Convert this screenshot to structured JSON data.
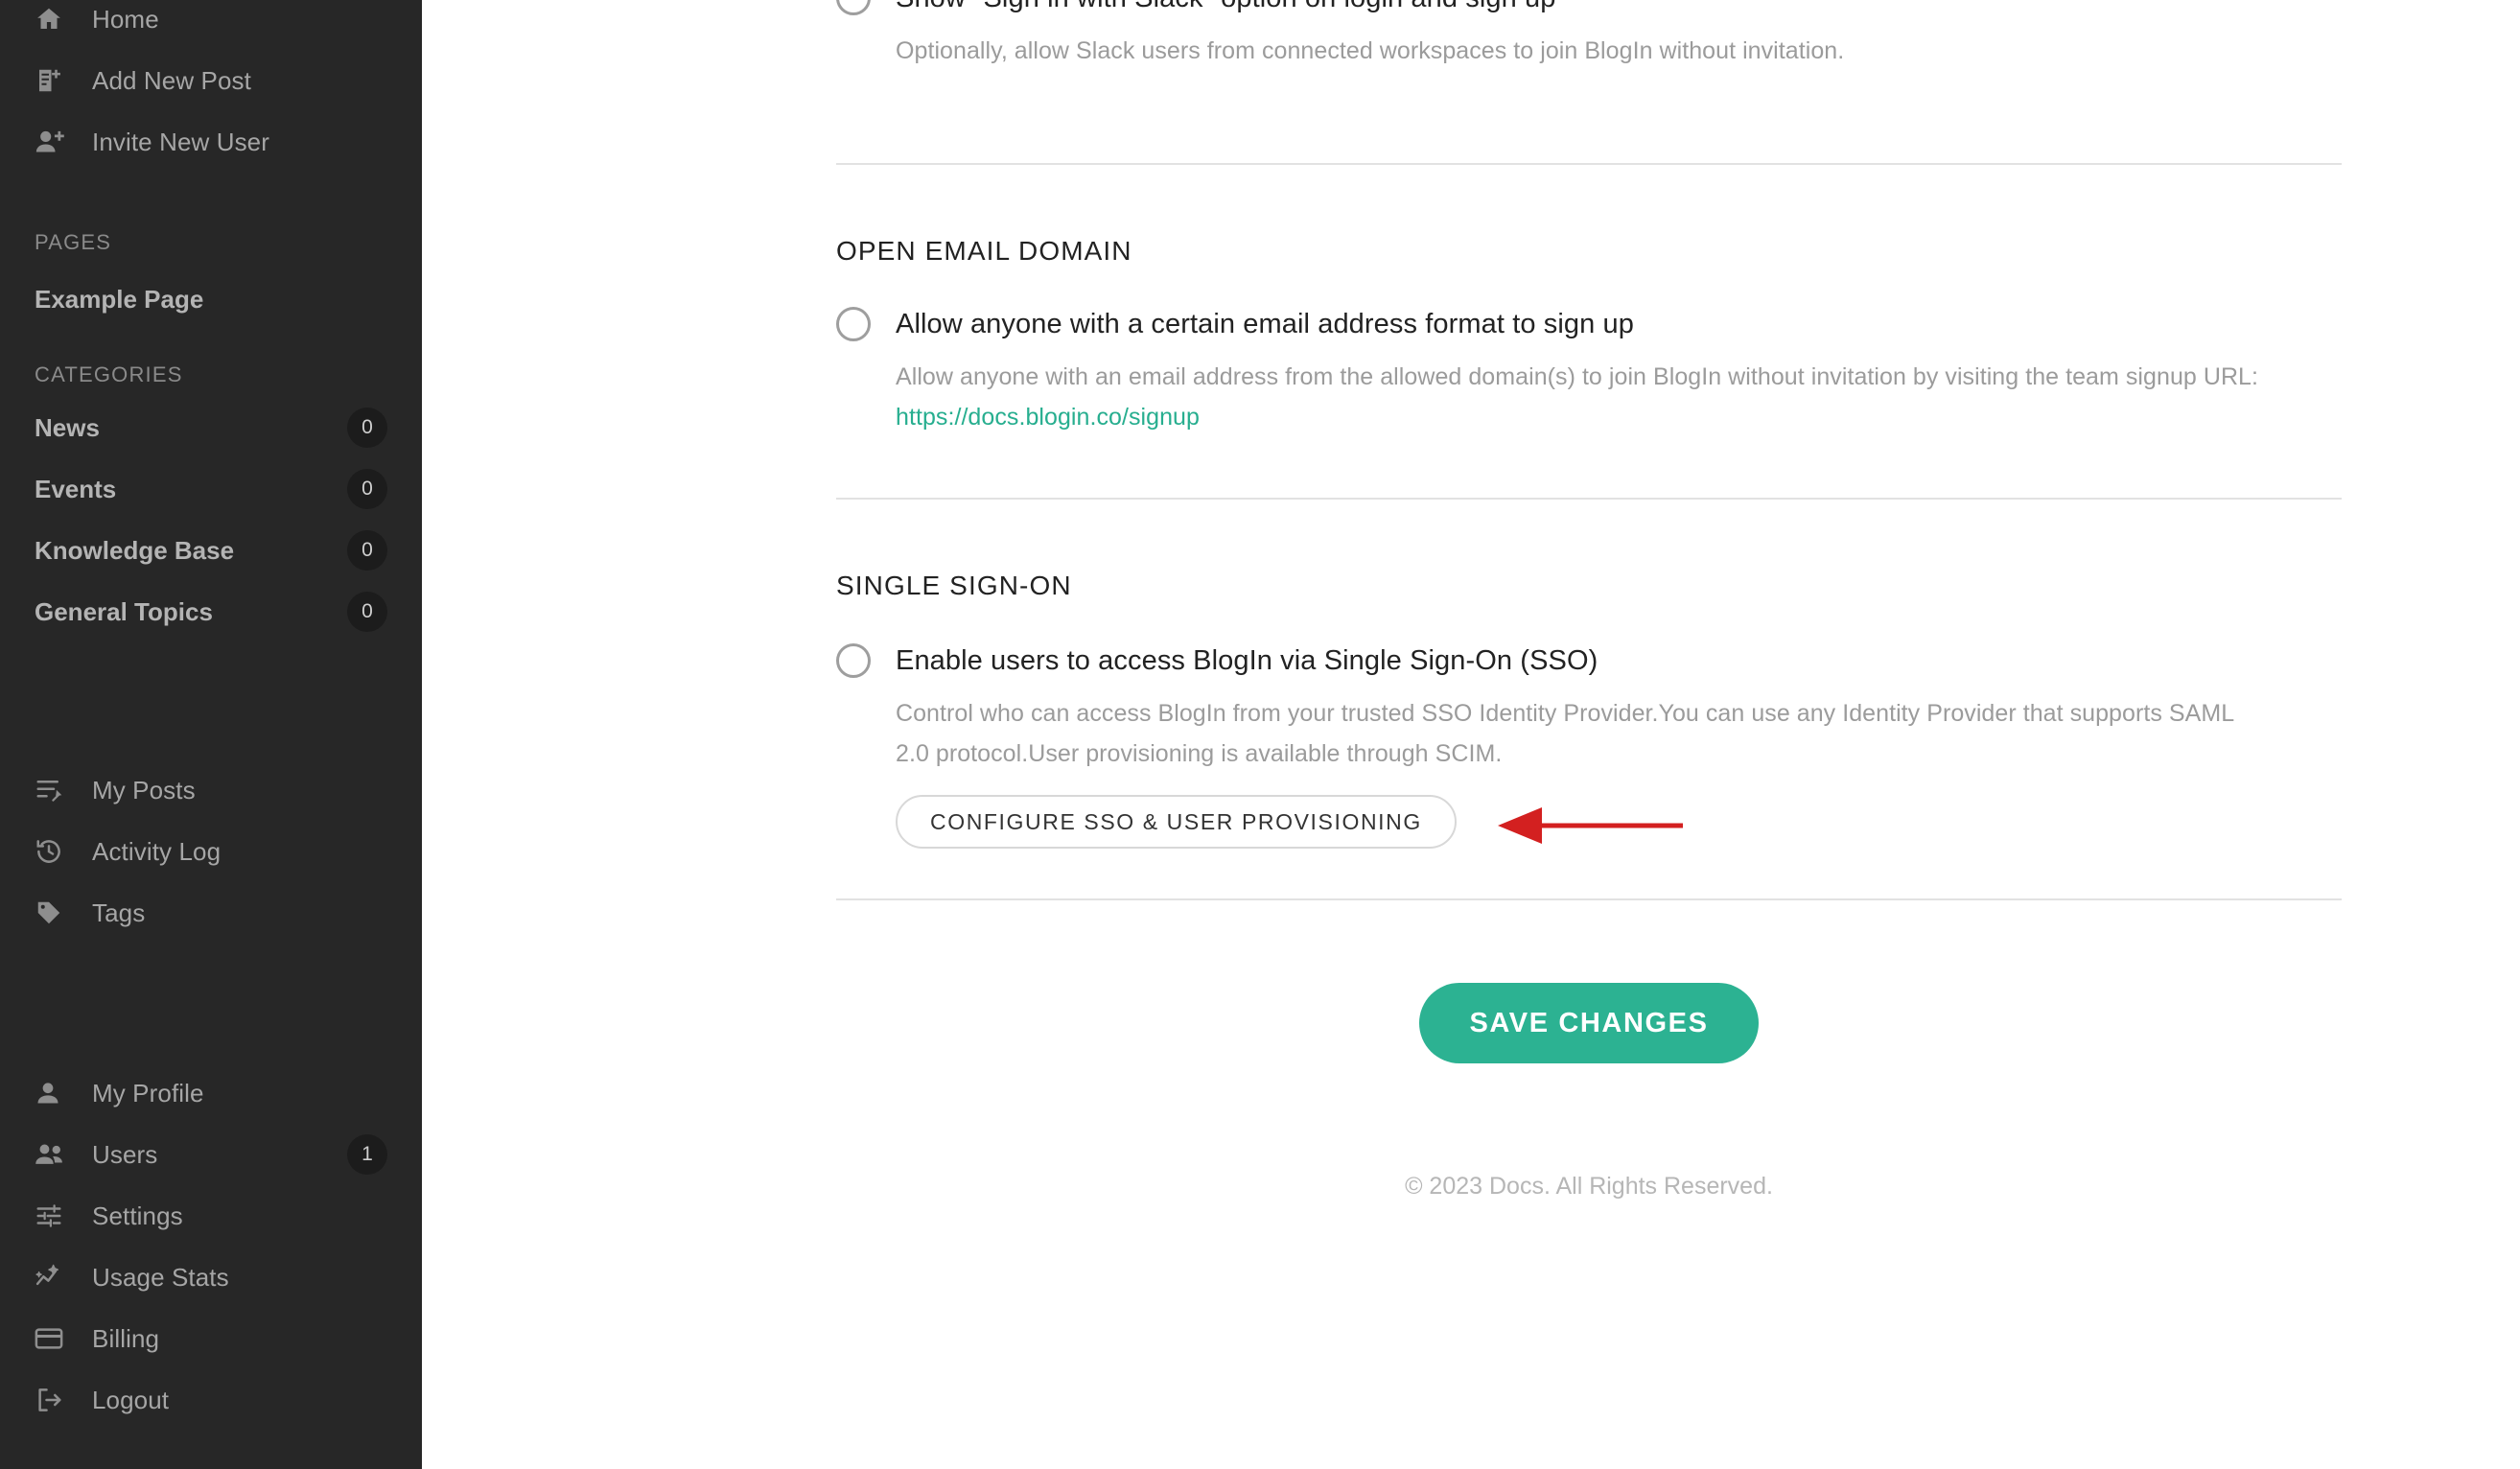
{
  "sidebar": {
    "top_items": [
      {
        "label": "Home",
        "icon": "home-icon"
      },
      {
        "label": "Add New Post",
        "icon": "add-post-icon"
      },
      {
        "label": "Invite New User",
        "icon": "invite-user-icon"
      }
    ],
    "pages_heading": "PAGES",
    "pages": [
      {
        "label": "Example Page"
      }
    ],
    "categories_heading": "CATEGORIES",
    "categories": [
      {
        "label": "News",
        "count": "0"
      },
      {
        "label": "Events",
        "count": "0"
      },
      {
        "label": "Knowledge Base",
        "count": "0"
      },
      {
        "label": "General Topics",
        "count": "0"
      }
    ],
    "mid_items": [
      {
        "label": "My Posts",
        "icon": "my-posts-icon"
      },
      {
        "label": "Activity Log",
        "icon": "activity-log-icon"
      },
      {
        "label": "Tags",
        "icon": "tag-icon"
      }
    ],
    "bottom_items": [
      {
        "label": "My Profile",
        "icon": "person-icon",
        "count": ""
      },
      {
        "label": "Users",
        "icon": "people-icon",
        "count": "1"
      },
      {
        "label": "Settings",
        "icon": "sliders-icon",
        "count": ""
      },
      {
        "label": "Usage Stats",
        "icon": "chart-sparkle-icon",
        "count": ""
      },
      {
        "label": "Billing",
        "icon": "credit-card-icon",
        "count": ""
      },
      {
        "label": "Logout",
        "icon": "logout-icon",
        "count": ""
      }
    ]
  },
  "main": {
    "slack_section": {
      "option_title": "Show \"Sign in with Slack\" option on login and sign up",
      "option_desc": "Optionally, allow Slack users from connected workspaces to join BlogIn without invitation."
    },
    "open_email_domain": {
      "heading": "OPEN EMAIL DOMAIN",
      "option_title": "Allow anyone with a certain email address format to sign up",
      "desc_before": "Allow anyone with an email address from the allowed domain(s) to join BlogIn without invitation by visiting the team signup URL: ",
      "link_text": "https://docs.blogin.co/signup"
    },
    "single_sign_on": {
      "heading": "SINGLE SIGN-ON",
      "option_title": "Enable users to access BlogIn via Single Sign-On (SSO)",
      "option_desc": "Control who can access BlogIn from your trusted SSO Identity Provider.You can use any Identity Provider that supports SAML 2.0 protocol.User provisioning is available through SCIM.",
      "configure_button": "CONFIGURE SSO & USER PROVISIONING"
    },
    "save_button": "SAVE CHANGES",
    "footer": "© 2023 Docs. All Rights Reserved."
  },
  "colors": {
    "sidebar_bg": "#272727",
    "accent_green": "#2cb292",
    "link_green": "#27ae8f",
    "arrow_red": "#d32020"
  }
}
